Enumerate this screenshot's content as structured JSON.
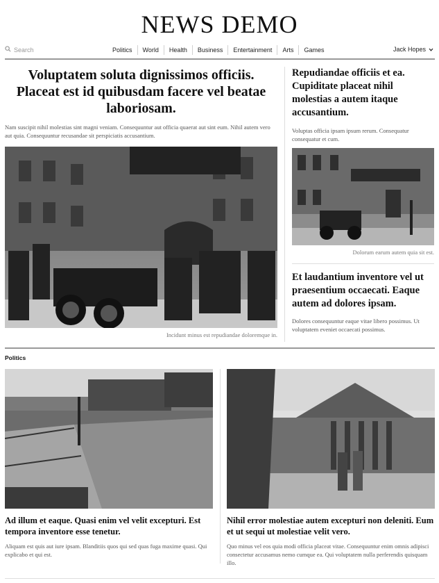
{
  "site": {
    "title": "NEWS DEMO"
  },
  "nav": {
    "search_placeholder": "Search",
    "links": [
      "Politics",
      "World",
      "Health",
      "Business",
      "Entertainment",
      "Arts",
      "Games"
    ],
    "user_name": "Jack Hopes"
  },
  "lead": {
    "headline": "Voluptatem soluta dignissimos officiis. Placeat est id quibusdam facere vel beatae laboriosam.",
    "summary": "Nam suscipit nihil molestias sint magni veniam. Consequuntur aut officia quaerat aut sint eum. Nihil autem vero aut quia. Consequuntur recusandae sit perspiciatis accusantium.",
    "caption": "Incidunt minus est repudiandae doloremque in."
  },
  "side": [
    {
      "headline": "Repudiandae officiis et ea. Cupiditate placeat nihil molestias a autem itaque accusantium.",
      "summary": "Voluptas officia ipsam ipsum rerum. Consequatur consequatur et cum.",
      "caption": "Dolorum earum autem quia sit est."
    },
    {
      "headline": "Et laudantium inventore vel ut praesentium occaecati. Eaque autem ad dolores ipsam.",
      "summary": "Dolores consequuntur eaque vitae libero possimus. Ut voluptatem eveniet occaecati possimus."
    }
  ],
  "section": {
    "label": "Politics",
    "cards": [
      {
        "headline": "Ad illum et eaque. Quasi enim vel velit excepturi. Est tempora inventore esse tenetur.",
        "summary": "Aliquam est quis aut iure ipsam. Blanditiis quos qui sed quas fuga maxime quasi. Qui explicabo et qui est."
      },
      {
        "headline": "Nihil error molestiae autem excepturi non deleniti. Eum et ut sequi ut molestiae velit vero.",
        "summary": "Quo minus vel eos quia modi officia placeat vitae. Consequuntur enim omnis adipisci consectetur accusamus nemo cumque ea. Qui voluptatem nulla perferendis quisquam illo."
      }
    ]
  },
  "colors": {
    "rule": "#999999",
    "divider": "#dddddd",
    "muted_text": "#555555"
  }
}
